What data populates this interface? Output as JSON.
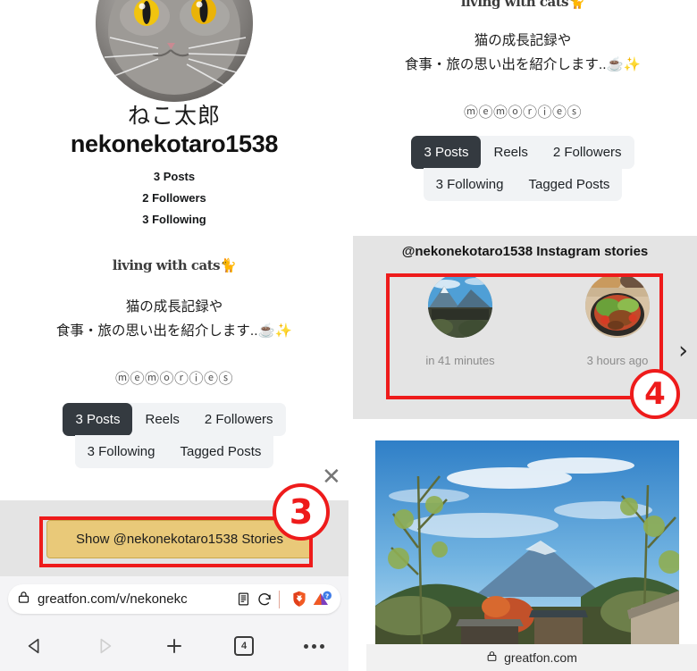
{
  "colors": {
    "accent_red": "#ee1b1b",
    "active_tab_bg": "#343a40",
    "tab_bar_bg": "#f1f3f5",
    "story_button_bg": "#e9c979",
    "sheet_bg": "#e4e4e4"
  },
  "profile": {
    "name": "ねこ太郎",
    "handle": "nekonekotaro1538",
    "stats": [
      "3 Posts",
      "2 Followers",
      "3 Following"
    ],
    "bio_title": "living with cats🐈",
    "bio_line_1": "猫の成長記録や",
    "bio_line_2": "食事・旅の思い出を紹介します..☕✨",
    "memories": "ⓜⓔⓜⓞⓡⓘⓔⓢ"
  },
  "tabs": {
    "row1": [
      {
        "label": "3 Posts",
        "active": true
      },
      {
        "label": "Reels",
        "active": false
      },
      {
        "label": "2 Followers",
        "active": false
      }
    ],
    "row2": [
      {
        "label": "3 Following",
        "active": false
      },
      {
        "label": "Tagged Posts",
        "active": false
      }
    ]
  },
  "story_sheet": {
    "button_label": "Show @nekonekotaro1538 Stories",
    "close_label": "✕"
  },
  "annotations": {
    "step_3": "3",
    "step_4": "4"
  },
  "stories": {
    "title": "@nekonekotaro1538 Instagram stories",
    "items": [
      {
        "time": "in 41 minutes",
        "thumb": "mountain-landscape"
      },
      {
        "time": "3 hours ago",
        "thumb": "food-bowl"
      }
    ],
    "next_arrow": "›",
    "close_label": "✕"
  },
  "photo_post": {
    "alt": "mount-fuji-photo"
  },
  "site_bar": {
    "domain": "greatfon.com",
    "lock_icon": "lock-icon"
  },
  "browser": {
    "url": "greatfon.com/v/nekonekc",
    "lock_icon": "lock-icon",
    "reader_icon": "reader-mode-icon",
    "reload_icon": "reload-icon",
    "shield_icon": "brave-shield-icon",
    "rewards_icon": "brave-rewards-icon",
    "nav": {
      "back": "back-icon",
      "forward": "forward-icon",
      "new_tab": "plus-icon",
      "tab_count": "4",
      "menu": "more-icon"
    }
  }
}
